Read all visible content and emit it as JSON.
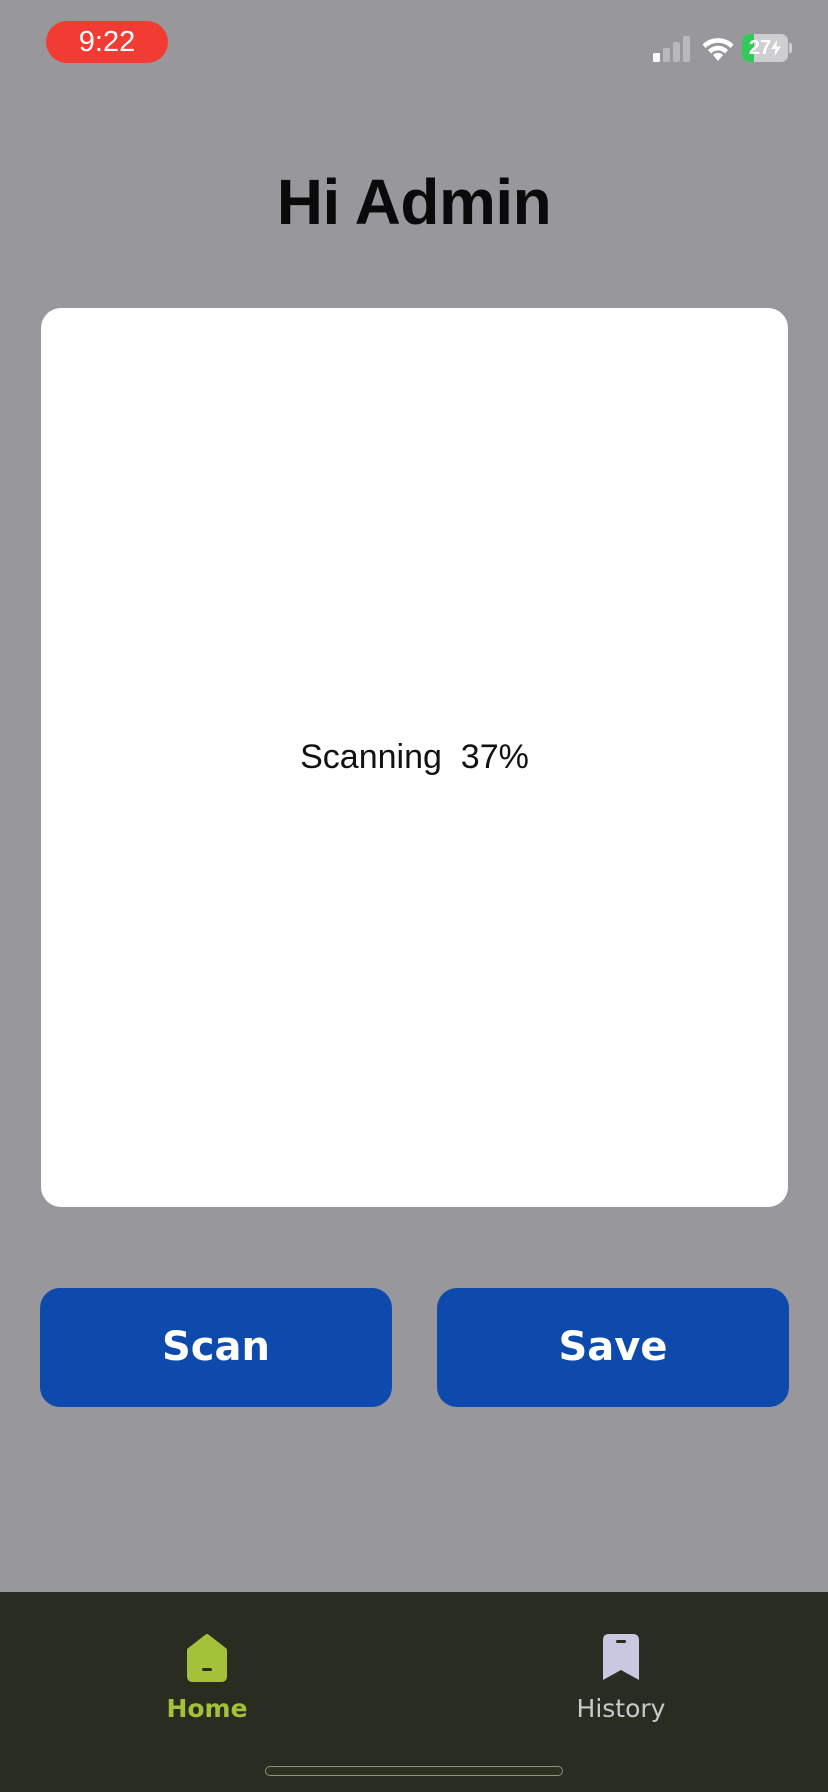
{
  "status_bar": {
    "time": "9:22",
    "battery_level": "27",
    "battery_fraction": 0.27,
    "signal_icon": "cellular-signal-icon",
    "wifi_icon": "wifi-icon",
    "charging_icon": "charging-bolt-icon"
  },
  "header": {
    "title": "Hi Admin"
  },
  "scanner": {
    "status_text": "Scanning  37%"
  },
  "actions": {
    "scan_label": "Scan",
    "save_label": "Save",
    "button_color": "#0d4aac"
  },
  "tab_bar": {
    "items": [
      {
        "label": "Home",
        "icon": "home-icon",
        "active": true,
        "color": "#a3c23a"
      },
      {
        "label": "History",
        "icon": "bookmark-icon",
        "active": false,
        "color": "#c9c9cc"
      }
    ]
  },
  "colors": {
    "background": "#98979b",
    "panel": "#ffffff",
    "tab_bar": "#292d21",
    "time_pill": "#f23b32"
  }
}
